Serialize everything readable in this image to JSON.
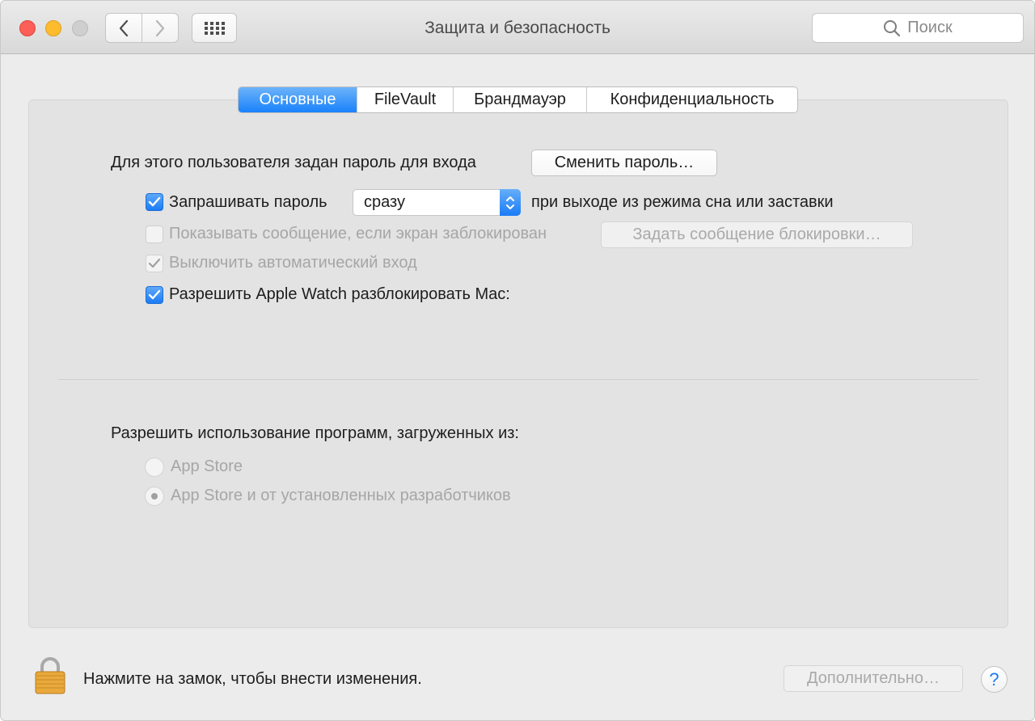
{
  "window": {
    "title": "Защита и безопасность"
  },
  "toolbar": {
    "back_icon": "chevron-left-icon",
    "forward_icon": "chevron-right-icon",
    "grid_icon": "grid-icon",
    "search_placeholder": "Поиск"
  },
  "tabs": [
    {
      "label": "Основные",
      "active": true
    },
    {
      "label": "FileVault",
      "active": false
    },
    {
      "label": "Брандмауэр",
      "active": false
    },
    {
      "label": "Конфиденциальность",
      "active": false
    }
  ],
  "general": {
    "password_text": "Для этого пользователя задан пароль для входа",
    "change_password_label": "Сменить пароль…",
    "require_password": {
      "label": "Запрашивать пароль",
      "checked": true,
      "enabled": true
    },
    "require_delay": {
      "value": "сразу"
    },
    "require_suffix": "при выходе из режима сна или заставки",
    "show_message": {
      "label": "Показывать сообщение, если экран заблокирован",
      "checked": false,
      "enabled": false
    },
    "set_lock_message_label": "Задать сообщение блокировки…",
    "disable_auto_login": {
      "label": "Выключить автоматический вход",
      "checked": true,
      "enabled": false
    },
    "apple_watch": {
      "label": "Разрешить Apple Watch разблокировать Mac:",
      "checked": true,
      "enabled": true
    }
  },
  "apps": {
    "heading": "Разрешить использование программ, загруженных из:",
    "options": [
      {
        "label": "App Store",
        "selected": false,
        "enabled": false
      },
      {
        "label": "App Store и от установленных разработчиков",
        "selected": true,
        "enabled": false
      }
    ]
  },
  "footer": {
    "lock_text": "Нажмите на замок, чтобы внести изменения.",
    "advanced_label": "Дополнительно…",
    "help_label": "?"
  },
  "colors": {
    "accent": "#1b7cf6",
    "close": "#fc5f57",
    "minimize": "#fdbc2e",
    "zoom_disabled": "#cfcfcf",
    "lock_gold": "#e9a93b"
  }
}
